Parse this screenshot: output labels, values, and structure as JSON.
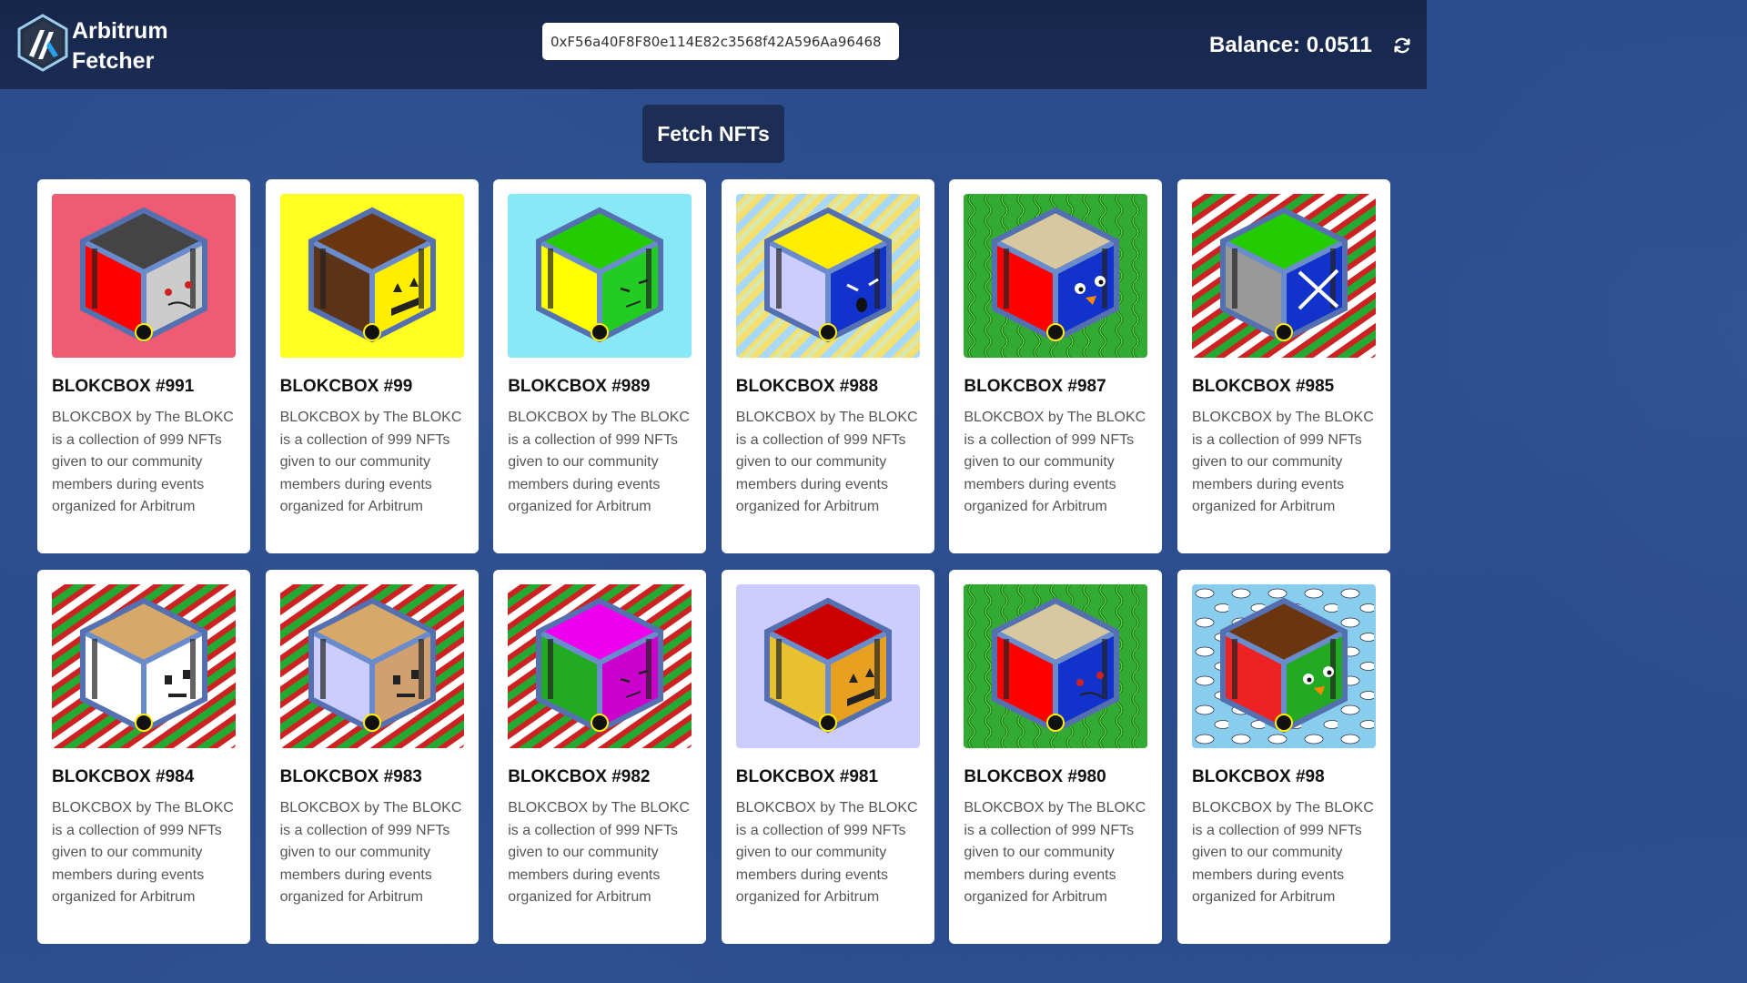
{
  "header": {
    "brand_line1": "Arbitrum",
    "brand_line2": "Fetcher",
    "address_value": "0xF56a40F8F80e114E82c3568f42A596Aa96468",
    "balance_label": "Balance: 0.0511",
    "logo_icon": "arbitrum-logo-icon",
    "refresh_icon": "refresh-icon"
  },
  "fetch_button_label": "Fetch NFTs",
  "nfts": [
    {
      "title": "BLOKCBOX #991",
      "desc": "BLOKCBOX by The BLOKC is a collection of 999 NFTs given to our community members during events organized for Arbitrum",
      "bg": "#ef5b72",
      "top": "#444444",
      "left": "#ff0000",
      "right": "#cccccc",
      "pattern": "solid",
      "face": "sad"
    },
    {
      "title": "BLOKCBOX #99",
      "desc": "BLOKCBOX by The BLOKC is a collection of 999 NFTs given to our community members during events organized for Arbitrum",
      "bg": "#ffff22",
      "top": "#6b3510",
      "left": "#5b3318",
      "right": "#ffee00",
      "pattern": "solid",
      "face": "jack"
    },
    {
      "title": "BLOKCBOX #989",
      "desc": "BLOKCBOX by The BLOKC is a collection of 999 NFTs given to our community members during events organized for Arbitrum",
      "bg": "#88e8f8",
      "top": "#22cc00",
      "left": "#ffff00",
      "right": "#22cc22",
      "pattern": "solid",
      "face": "grumpy"
    },
    {
      "title": "BLOKCBOX #988",
      "desc": "BLOKCBOX by The BLOKC is a collection of 999 NFTs given to our community members during events organized for Arbitrum",
      "bg": "#f4e070",
      "top": "#ffee00",
      "left": "#ccccff",
      "right": "#1133cc",
      "pattern": "stripes-pastel",
      "face": "angry"
    },
    {
      "title": "BLOKCBOX #987",
      "desc": "BLOKCBOX by The BLOKC is a collection of 999 NFTs given to our community members during events organized for Arbitrum",
      "bg": "#33aa33",
      "top": "#d8c8a0",
      "left": "#ff0000",
      "right": "#1133cc",
      "pattern": "vines",
      "face": "bird"
    },
    {
      "title": "BLOKCBOX #985",
      "desc": "BLOKCBOX by The BLOKC is a collection of 999 NFTs given to our community members during events organized for Arbitrum",
      "bg": "#cc2222",
      "top": "#22cc00",
      "left": "#999999",
      "right": "#1133cc",
      "pattern": "stripes-xmas",
      "face": "x"
    },
    {
      "title": "BLOKCBOX #984",
      "desc": "BLOKCBOX by The BLOKC is a collection of 999 NFTs given to our community members during events organized for Arbitrum",
      "bg": "#cc2222",
      "top": "#d8a868",
      "left": "#ffffff",
      "right": "#ffffff",
      "pattern": "stripes-xmas",
      "face": "robot"
    },
    {
      "title": "BLOKCBOX #983",
      "desc": "BLOKCBOX by The BLOKC is a collection of 999 NFTs given to our community members during events organized for Arbitrum",
      "bg": "#cc2222",
      "top": "#d8a868",
      "left": "#ccccff",
      "right": "#d0a070",
      "pattern": "stripes-xmas",
      "face": "robot"
    },
    {
      "title": "BLOKCBOX #982",
      "desc": "BLOKCBOX by The BLOKC is a collection of 999 NFTs given to our community members during events organized for Arbitrum",
      "bg": "#cc2222",
      "top": "#ee00ee",
      "left": "#22aa22",
      "right": "#cc00cc",
      "pattern": "stripes-xmas",
      "face": "grumpy"
    },
    {
      "title": "BLOKCBOX #981",
      "desc": "BLOKCBOX by The BLOKC is a collection of 999 NFTs given to our community members during events organized for Arbitrum",
      "bg": "#ccccff",
      "top": "#cc0000",
      "left": "#e8c030",
      "right": "#e8a020",
      "pattern": "solid",
      "face": "jack"
    },
    {
      "title": "BLOKCBOX #980",
      "desc": "BLOKCBOX by The BLOKC is a collection of 999 NFTs given to our community members during events organized for Arbitrum",
      "bg": "#33aa33",
      "top": "#d8c8a0",
      "left": "#ff0000",
      "right": "#1133cc",
      "pattern": "vines",
      "face": "sad"
    },
    {
      "title": "BLOKCBOX #98",
      "desc": "BLOKCBOX by The BLOKC is a collection of 999 NFTs given to our community members during events organized for Arbitrum",
      "bg": "#88ccee",
      "top": "#6b3510",
      "left": "#ee2222",
      "right": "#22aa22",
      "pattern": "clouds",
      "face": "bird"
    }
  ]
}
